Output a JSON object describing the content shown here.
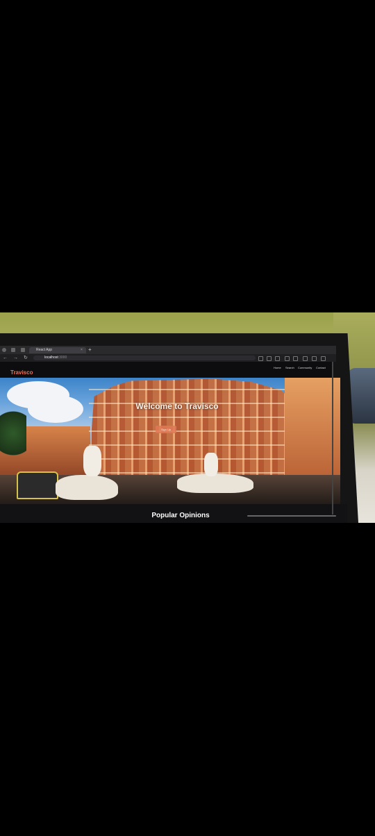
{
  "browser": {
    "tab_title": "React App",
    "tab_close": "×",
    "new_tab": "+",
    "url_host": "localhost",
    "url_port": ":3000",
    "nav_back": "←",
    "nav_forward": "→",
    "nav_reload": "↻"
  },
  "site": {
    "brand": "Travisco",
    "nav": {
      "home": "Home",
      "search": "Search",
      "community": "Community",
      "contact": "Contact"
    },
    "hero": {
      "heading": "Welcome to Travisco",
      "cta": "Sign Up"
    },
    "section_title": "Popular Opinions"
  }
}
